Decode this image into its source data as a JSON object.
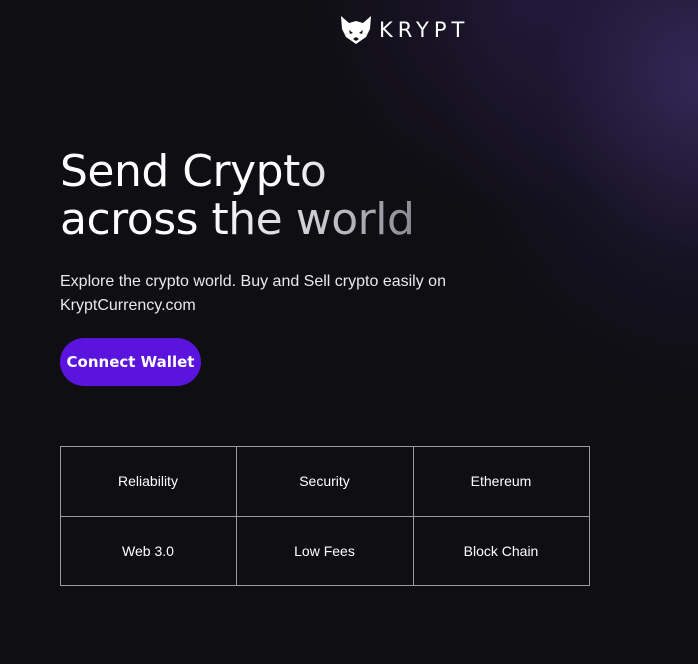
{
  "brand": {
    "name": "KRYPT",
    "logo_icon": "fox-icon"
  },
  "hero": {
    "title_line1": "Send Crypto",
    "title_line2": "across the world",
    "subtitle": "Explore the crypto world. Buy and Sell crypto easily on KryptCurrency.com",
    "connect_label": "Connect Wallet"
  },
  "features": [
    {
      "label": "Reliability"
    },
    {
      "label": "Security"
    },
    {
      "label": "Ethereum"
    },
    {
      "label": "Web 3.0"
    },
    {
      "label": "Low Fees"
    },
    {
      "label": "Block Chain"
    }
  ],
  "colors": {
    "background": "#0f0e13",
    "accent": "#5a14de",
    "grid_border": "#9a9aa2"
  }
}
